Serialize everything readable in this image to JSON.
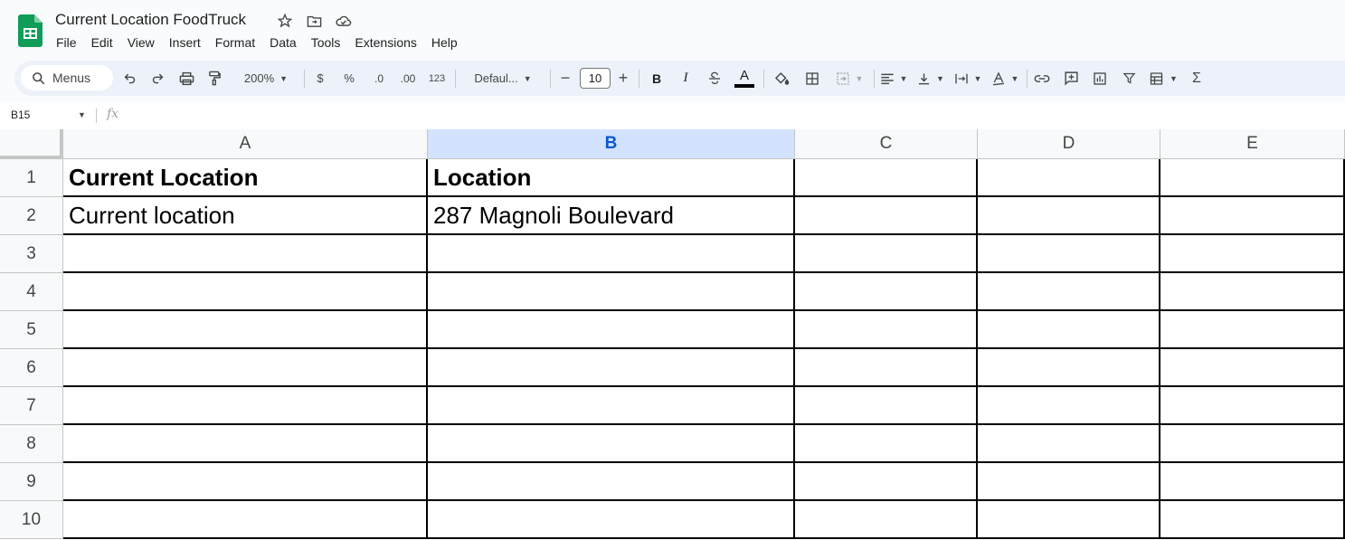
{
  "doc": {
    "title": "Current Location FoodTruck"
  },
  "menu": [
    "File",
    "Edit",
    "View",
    "Insert",
    "Format",
    "Data",
    "Tools",
    "Extensions",
    "Help"
  ],
  "toolbar": {
    "search_label": "Menus",
    "zoom": "200%",
    "currency": "$",
    "percent": "%",
    "decrease_decimal": ".0",
    "increase_decimal": ".00",
    "number_format": "123",
    "font": "Defaul...",
    "font_size": "10",
    "bold": "B",
    "italic": "I",
    "text_color_letter": "A",
    "sum": "Σ"
  },
  "formula_bar": {
    "cell_ref": "B15",
    "fx": "fx"
  },
  "grid": {
    "columns": [
      "A",
      "B",
      "C",
      "D",
      "E"
    ],
    "selected_column": "B",
    "rows": [
      "1",
      "2",
      "3",
      "4",
      "5",
      "6",
      "7",
      "8",
      "9",
      "10"
    ],
    "cells": {
      "A1": "Current Location",
      "B1": "Location",
      "A2": "Current location",
      "B2": "287 Magnoli Boulevard"
    }
  },
  "colors": {
    "accent": "#0b57d0",
    "selected_header": "#d3e3fd",
    "sheets_green": "#0f9d58"
  }
}
